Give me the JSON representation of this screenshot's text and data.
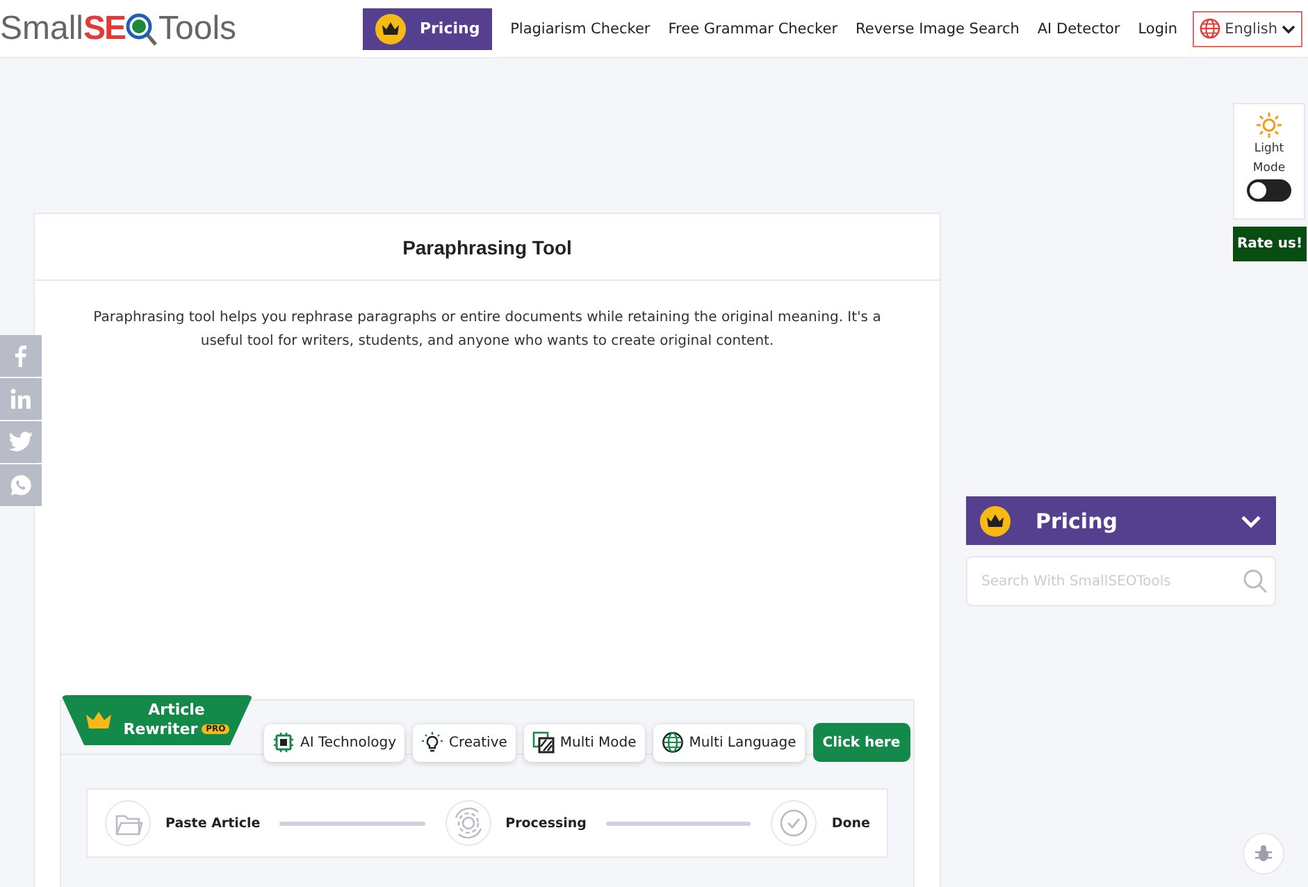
{
  "header": {
    "logo": [
      "Small",
      "SE",
      "Tools"
    ],
    "pricing_button": "Pricing",
    "nav": [
      "Plagiarism Checker",
      "Free Grammar Checker",
      "Reverse Image Search",
      "AI Detector",
      "Login"
    ],
    "language": "English"
  },
  "theme_widget": {
    "label_1": "Light",
    "label_2": "Mode",
    "dark_mode": false
  },
  "rate_button": "Rate us!",
  "social": [
    {
      "kind": "facebook"
    },
    {
      "kind": "linkedin"
    },
    {
      "kind": "twitter"
    },
    {
      "kind": "whatsapp"
    }
  ],
  "tool": {
    "title": "Paraphrasing Tool",
    "description": "Paraphrasing tool helps you rephrase paragraphs or entire documents while retaining the original meaning. It's a useful tool for writers, students, and anyone who wants to create original content."
  },
  "rewriter": {
    "title_1": "Article",
    "title_2": "Rewriter",
    "badge": "PRO",
    "features": [
      {
        "kind": "chip",
        "label": "AI Technology"
      },
      {
        "kind": "bulb",
        "label": "Creative"
      },
      {
        "kind": "modes",
        "label": "Multi Mode"
      },
      {
        "kind": "globe",
        "label": "Multi Language"
      }
    ],
    "cta": "Click here",
    "steps": [
      {
        "kind": "folder",
        "label": "Paste Article"
      },
      {
        "kind": "gear",
        "label": "Processing"
      },
      {
        "kind": "check",
        "label": "Done"
      }
    ]
  },
  "sidebar": {
    "pricing": "Pricing",
    "search": {
      "placeholder": "Search With SmallSEOTools"
    }
  }
}
